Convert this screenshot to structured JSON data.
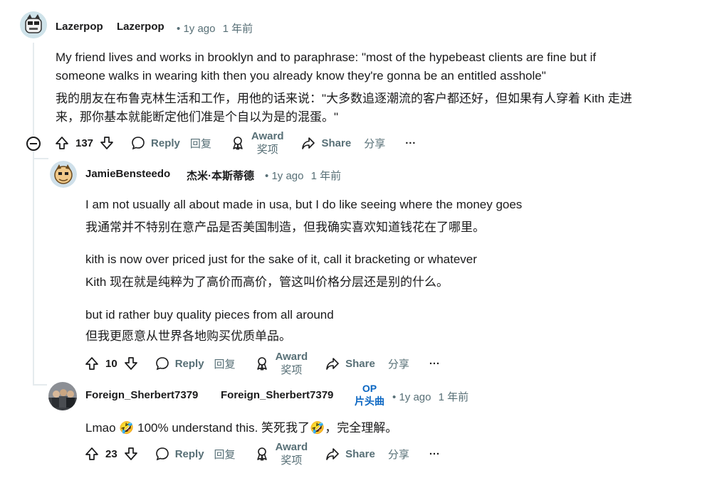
{
  "comments": [
    {
      "author": "Lazerpop",
      "author_cn": "Lazerpop",
      "age": "1y ago",
      "age_cn": "1 年前",
      "text": [
        "My friend lives and works in brooklyn and to paraphrase: \"most of the hypebeast clients are fine but if",
        "someone walks in wearing kith then you already know they're gonna be an entitled asshole\"",
        "我的朋友在布鲁克林生活和工作，用他的话来说：\"大多数追逐潮流的客户都还好，但如果有人穿着 Kith 走进",
        "来，那你基本就能断定他们准是个自以为是的混蛋。\""
      ],
      "votes": "137"
    },
    {
      "author": "JamieBensteedo",
      "author_cn": "杰米·本斯蒂德",
      "age": "1y ago",
      "age_cn": "1 年前",
      "text": [
        "I am not usually all about made in usa, but I do like seeing where the money goes",
        "我通常并不特别在意产品是否美国制造，但我确实喜欢知道钱花在了哪里。",
        "kith is now over priced just for the sake of it, call it bracketing or whatever",
        "Kith 现在就是纯粹为了高价而高价，管这叫价格分层还是别的什么。",
        "but id rather buy quality pieces from all around",
        "但我更愿意从世界各地购买优质单品。"
      ],
      "votes": "10"
    },
    {
      "author": "Foreign_Sherbert7379",
      "author_cn": "Foreign_Sherbert7379",
      "op": "OP",
      "op_cn": "片头曲",
      "age": "1y ago",
      "age_cn": "1 年前",
      "text": [
        "Lmao 🤣 100% understand this.   笑死我了🤣，完全理解。"
      ],
      "votes": "23"
    }
  ],
  "actions": {
    "reply": "Reply",
    "reply_cn": "回复",
    "award": "Award",
    "award_cn": "奖项",
    "share": "Share",
    "share_cn": "分享",
    "more": "···"
  },
  "dot": "•",
  "icons": [
    "upvote-icon",
    "downvote-icon",
    "comment-icon",
    "award-icon",
    "share-icon",
    "more-icon",
    "collapse-icon"
  ],
  "colors": {
    "meta": "#576f76",
    "op": "#0a66c2",
    "text": "#1a1a1b",
    "thread": "#e5ebee"
  }
}
